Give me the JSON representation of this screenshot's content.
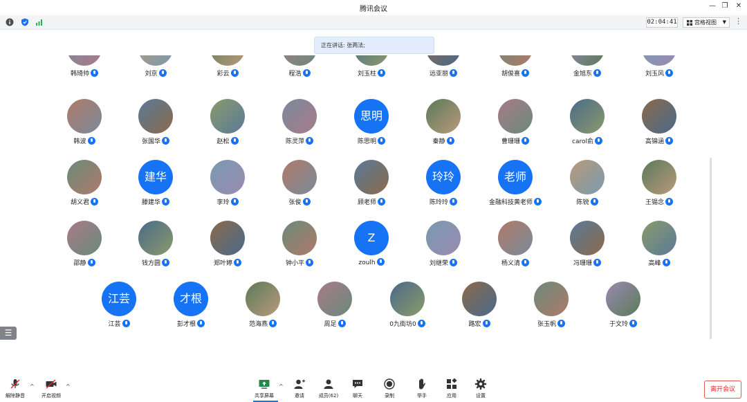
{
  "window": {
    "title": "腾讯会议"
  },
  "toolbar": {
    "timer": "02:04:41",
    "view_label": "宫格视图"
  },
  "speaker_banner": "正在讲话: 张两法;",
  "participants": [
    {
      "name": "韩琦帅",
      "avatar": "photo"
    },
    {
      "name": "刘京",
      "avatar": "photo"
    },
    {
      "name": "彩云",
      "avatar": "photo"
    },
    {
      "name": "程浩",
      "avatar": "photo"
    },
    {
      "name": "刘玉柱",
      "avatar": "photo"
    },
    {
      "name": "远亚丽",
      "avatar": "photo"
    },
    {
      "name": "胡俊喜",
      "avatar": "photo"
    },
    {
      "name": "金旭东",
      "avatar": "photo"
    },
    {
      "name": "刘玉风",
      "avatar": "photo"
    },
    {
      "name": "韩波",
      "avatar": "photo"
    },
    {
      "name": "张国华",
      "avatar": "photo"
    },
    {
      "name": "赵松",
      "avatar": "photo"
    },
    {
      "name": "陈灵萍",
      "avatar": "photo"
    },
    {
      "name": "陈思明",
      "avatar": "text",
      "text": "思明"
    },
    {
      "name": "秦静",
      "avatar": "photo"
    },
    {
      "name": "曹珊珊",
      "avatar": "photo"
    },
    {
      "name": "carol俞",
      "avatar": "photo"
    },
    {
      "name": "高锦涵",
      "avatar": "photo"
    },
    {
      "name": "胡义君",
      "avatar": "photo"
    },
    {
      "name": "滕建华",
      "avatar": "text",
      "text": "建华"
    },
    {
      "name": "李玲",
      "avatar": "photo"
    },
    {
      "name": "张俊",
      "avatar": "photo"
    },
    {
      "name": "顾老师",
      "avatar": "photo"
    },
    {
      "name": "陈玲玲",
      "avatar": "text",
      "text": "玲玲"
    },
    {
      "name": "金融科技黄老师",
      "avatar": "text",
      "text": "老师"
    },
    {
      "name": "陈锐",
      "avatar": "photo"
    },
    {
      "name": "王锡念",
      "avatar": "photo"
    },
    {
      "name": "邵静",
      "avatar": "photo"
    },
    {
      "name": "钱方圆",
      "avatar": "photo"
    },
    {
      "name": "郑叶婷",
      "avatar": "photo"
    },
    {
      "name": "钟小平",
      "avatar": "photo"
    },
    {
      "name": "zoulh",
      "avatar": "text",
      "text": "Z"
    },
    {
      "name": "刘继荣",
      "avatar": "photo"
    },
    {
      "name": "杨义清",
      "avatar": "photo"
    },
    {
      "name": "冯珊珊",
      "avatar": "photo"
    },
    {
      "name": "高峰",
      "avatar": "photo"
    },
    {
      "name": "江芸",
      "avatar": "text",
      "text": "江芸"
    },
    {
      "name": "彭才根",
      "avatar": "text",
      "text": "才根"
    },
    {
      "name": "范海燕",
      "avatar": "photo"
    },
    {
      "name": "周足",
      "avatar": "photo"
    },
    {
      "name": "0九街坊0",
      "avatar": "photo"
    },
    {
      "name": "路宏",
      "avatar": "photo"
    },
    {
      "name": "张玉帆",
      "avatar": "photo"
    },
    {
      "name": "于文玲",
      "avatar": "photo"
    }
  ],
  "bottom_bar": {
    "unmute": "解除静音",
    "start_video": "开启视频",
    "share_screen": "共享屏幕",
    "invite": "邀请",
    "members": "成员(62)",
    "chat": "聊天",
    "record": "录制",
    "raise_hand": "举手",
    "apps": "应用",
    "settings": "设置",
    "leave": "离开会议"
  },
  "colors": {
    "accent": "#1673f6",
    "leave": "#e02b2b"
  }
}
